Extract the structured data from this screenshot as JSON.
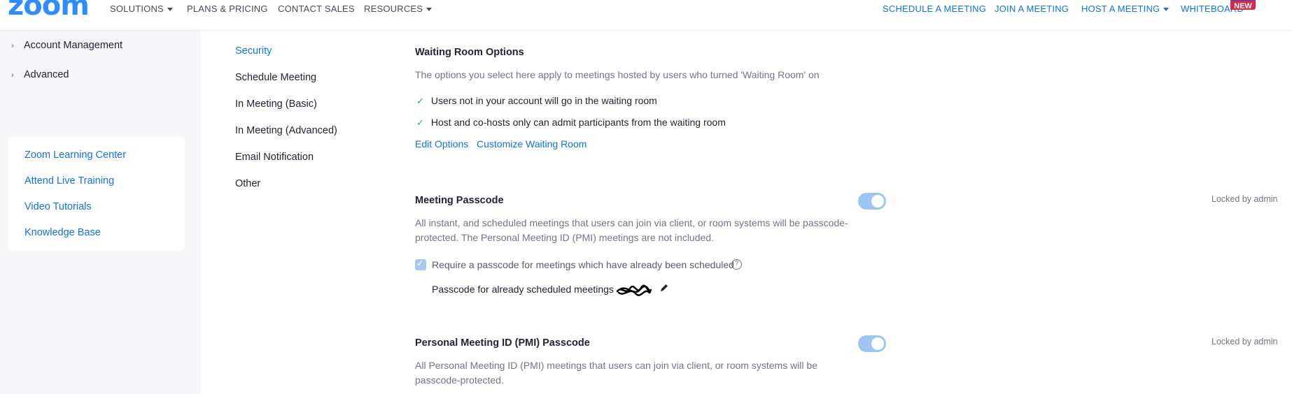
{
  "nav": {
    "logo": "zoom",
    "left_links": [
      {
        "label": "SOLUTIONS",
        "dropdown": true
      },
      {
        "label": "PLANS & PRICING",
        "dropdown": false
      },
      {
        "label": "CONTACT SALES",
        "dropdown": false
      },
      {
        "label": "RESOURCES",
        "dropdown": true
      }
    ],
    "right_links": [
      {
        "label": "SCHEDULE A MEETING",
        "dropdown": false
      },
      {
        "label": "JOIN A MEETING",
        "dropdown": false
      },
      {
        "label": "HOST A MEETING",
        "dropdown": true
      },
      {
        "label": "WHITEBOARD",
        "dropdown": false
      }
    ],
    "new_badge": "NEW"
  },
  "sidebar": {
    "items": [
      {
        "label": "Account Management",
        "icon": "chevron-right-icon"
      },
      {
        "label": "Advanced",
        "icon": "chevron-right-icon"
      }
    ],
    "help_links": [
      "Zoom Learning Center",
      "Attend Live Training",
      "Video Tutorials",
      "Knowledge Base"
    ]
  },
  "subnav": {
    "items": [
      "Security",
      "Schedule Meeting",
      "In Meeting (Basic)",
      "In Meeting (Advanced)",
      "Email Notification",
      "Other"
    ],
    "active_index": 0
  },
  "waiting_room": {
    "title": "Waiting Room Options",
    "description": "The options you select here apply to meetings hosted by users who turned 'Waiting Room' on",
    "options": [
      "Users not in your account will go in the waiting room",
      "Host and co-hosts only can admit participants from the waiting room"
    ],
    "edit_options": "Edit Options",
    "customize": "Customize Waiting Room"
  },
  "meeting_passcode": {
    "title": "Meeting Passcode",
    "enabled": true,
    "locked": "Locked by admin",
    "description_line1": "All instant, and scheduled meetings that users can join via client, or room systems will be passcode-",
    "description_line2": "protected. The Personal Meeting ID (PMI) meetings are not included.",
    "checkbox_label": "Require a passcode for meetings which have already been scheduled",
    "checkbox_checked": true,
    "passcode_label": "Passcode for already scheduled meetings"
  },
  "pmi_passcode": {
    "title": "Personal Meeting ID (PMI) Passcode",
    "enabled": true,
    "locked": "Locked by admin",
    "description_line1": "All Personal Meeting ID (PMI) meetings that users can join via client, or room systems will be",
    "description_line2": "passcode-protected."
  },
  "colors": {
    "brand": "#2d8cff",
    "link": "#0e72ed",
    "toggle_on": "#9ec5f2",
    "badge": "#d8274a"
  }
}
